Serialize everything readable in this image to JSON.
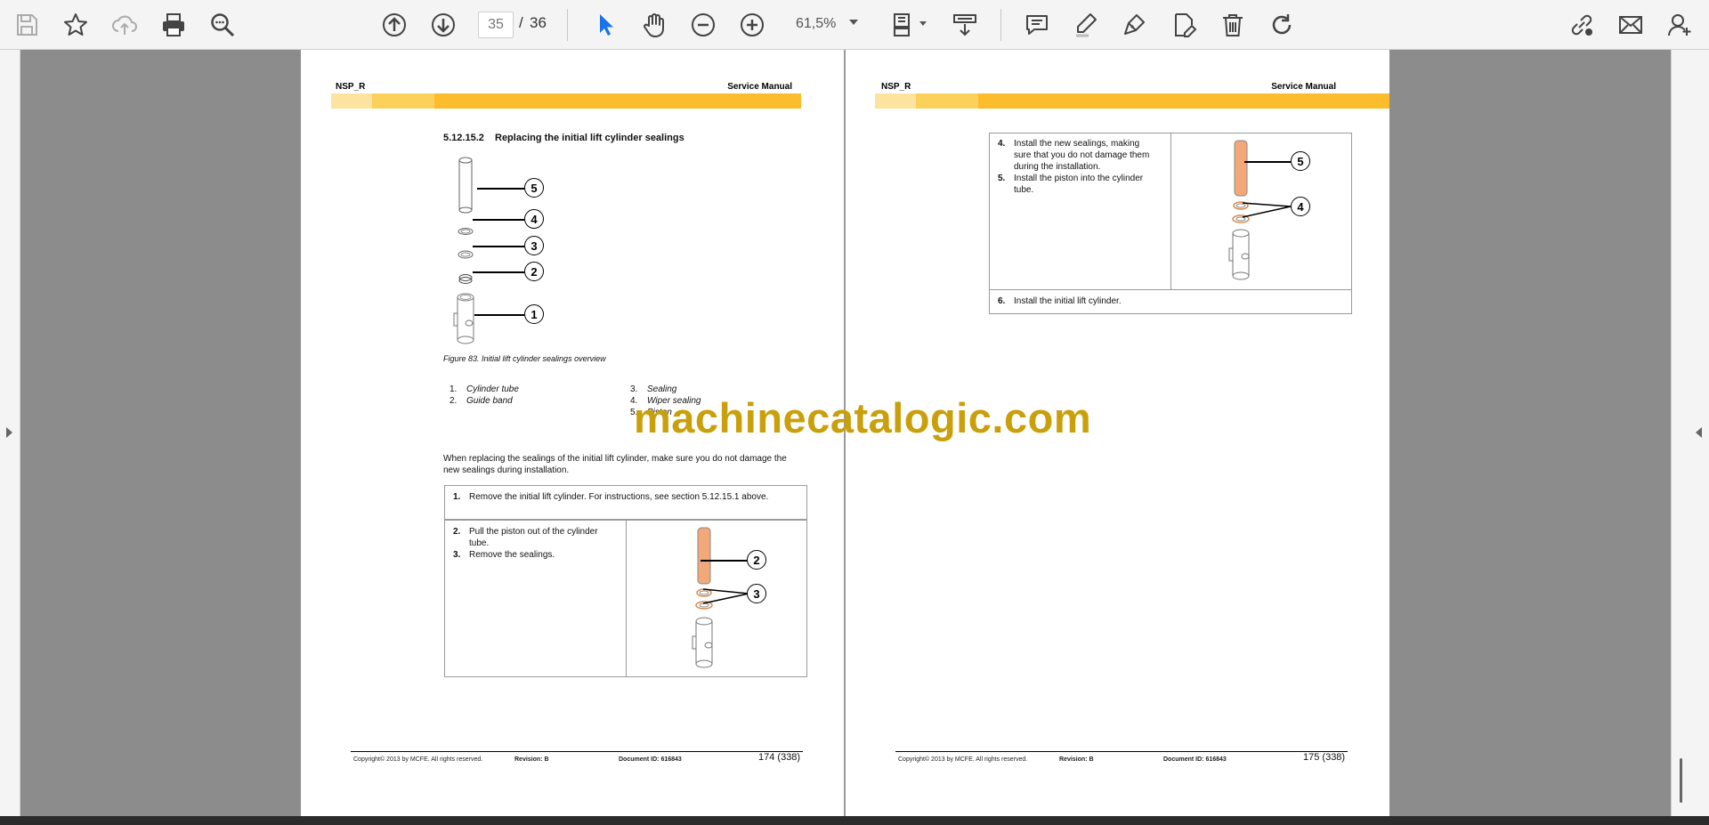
{
  "toolbar": {
    "icons": [
      "save-icon",
      "bookmark-star-icon",
      "cloud-upload-icon",
      "print-icon",
      "zoom-search-icon",
      "previous-page-icon",
      "next-page-icon",
      "select-cursor-icon",
      "hand-tool-icon",
      "zoom-out-icon",
      "zoom-in-icon",
      "page-fit-icon",
      "scroll-mode-icon",
      "comment-icon",
      "highlight-pen-icon",
      "sign-icon",
      "fill-sign-icon",
      "delete-icon",
      "rotate-icon",
      "share-link-icon",
      "email-icon",
      "add-user-icon"
    ],
    "current_page": "35",
    "page_separator": "/",
    "total_pages": "36",
    "zoom": "61,5%"
  },
  "colors": {
    "band_light": "#fde3a0",
    "band_mid": "#fcd15b",
    "band_dark": "#fbbd2c",
    "tube_orange": "#f2a878",
    "watermark": "#c9a00c",
    "cursor_blue": "#1a73e8"
  },
  "watermark": "machinecatalogic.com",
  "left_page": {
    "header_left": "NSP_R",
    "header_right": "Service Manual",
    "section_number": "5.12.15.2",
    "section_title": "Replacing the initial lift cylinder sealings",
    "figure_callouts": [
      "5",
      "4",
      "3",
      "2",
      "1"
    ],
    "figure_caption": "Figure 83. Initial lift cylinder sealings overview",
    "legend": [
      {
        "num": "1.",
        "label": "Cylinder tube"
      },
      {
        "num": "2.",
        "label": "Guide band"
      },
      {
        "num": "3.",
        "label": "Sealing"
      },
      {
        "num": "4.",
        "label": "Wiper sealing"
      },
      {
        "num": "5.",
        "label": "Piston"
      }
    ],
    "intro_line1": "When replacing the sealings of the initial lift cylinder, make sure you do not damage the",
    "intro_line2": "new sealings during installation.",
    "step1_num": "1.",
    "step1_text": "Remove the initial lift cylinder. For instructions, see section 5.12.15.1 above.",
    "step2_num": "2.",
    "step2_line1": "Pull the piston out of the cylinder",
    "step2_line2": "tube.",
    "step3_num": "3.",
    "step3_text": "Remove the sealings.",
    "step_callouts": [
      "2",
      "3"
    ],
    "footer_copyright": "Copyright© 2013 by MCFE. All rights reserved.",
    "footer_revision": "Revision: B",
    "footer_docid": "Document ID: 616843",
    "footer_page": "174 (338)"
  },
  "right_page": {
    "header_left": "NSP_R",
    "header_right": "Service Manual",
    "step4_num": "4.",
    "step4_line1": "Install the new sealings, making",
    "step4_line2": "sure that you do not damage them",
    "step4_line3": "during the installation.",
    "step5_num": "5.",
    "step5_line1": "Install the piston into the cylinder",
    "step5_line2": "tube.",
    "step6_num": "6.",
    "step6_text": "Install the initial lift cylinder.",
    "step_callouts": [
      "5",
      "4"
    ],
    "footer_copyright": "Copyright© 2013 by MCFE. All rights reserved.",
    "footer_revision": "Revision: B",
    "footer_docid": "Document ID: 616843",
    "footer_page": "175 (338)"
  }
}
